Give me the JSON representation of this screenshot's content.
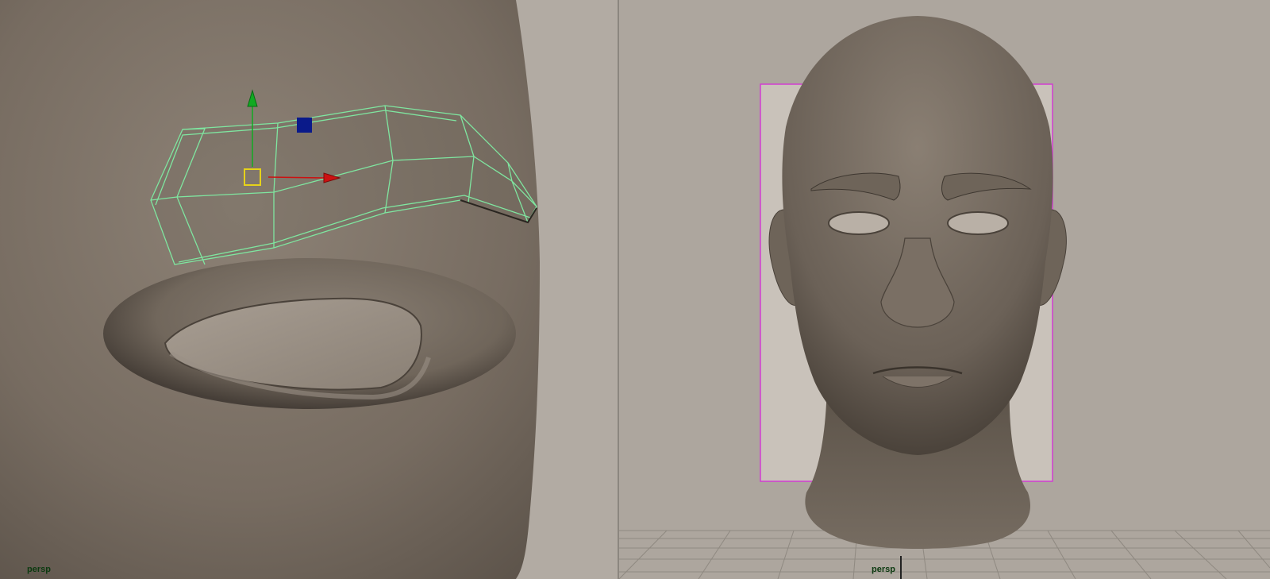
{
  "viewports": {
    "left": {
      "camera_label": "persp"
    },
    "right": {
      "camera_label": "persp"
    }
  },
  "colors": {
    "background": "#aaa39b",
    "mesh_skin": "#7a7065",
    "wireframe_selected": "#7fe6a0",
    "manip_x_axis": "#cc1111",
    "manip_y_axis": "#11aa22",
    "manip_z_handle": "#0a1a8a",
    "manip_center": "#e6d21a",
    "image_plane_border": "#d23cd2",
    "camera_label": "#0c3a10"
  },
  "icons": {
    "move_manipulator": "move-manipulator-icon",
    "grid": "ground-grid"
  }
}
